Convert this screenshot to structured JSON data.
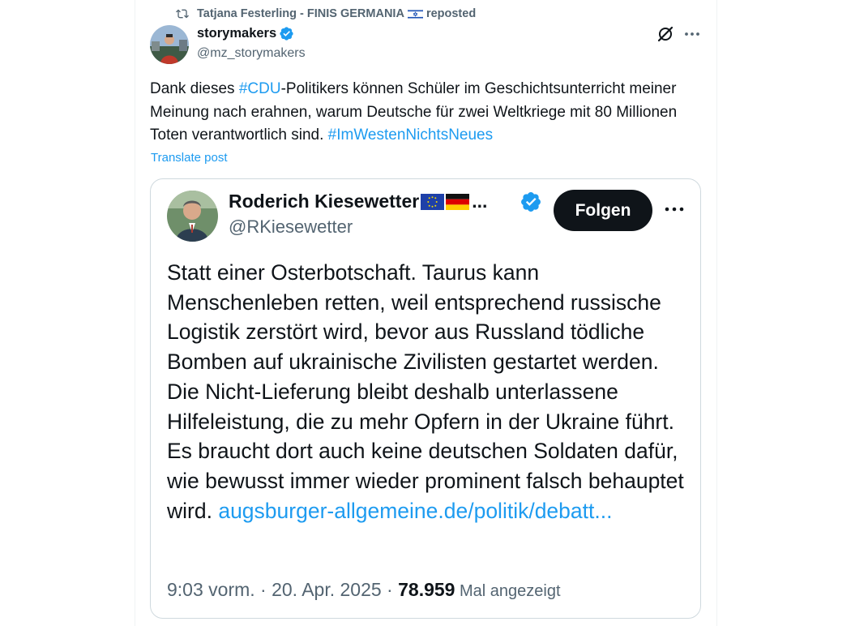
{
  "repost": {
    "user": "Tatjana Festerling - FINIS GERMANIA",
    "label": "reposted",
    "icon": "repost-icon"
  },
  "post": {
    "display_name": "storymakers",
    "handle": "@mz_storymakers",
    "text_1": "Dank dieses ",
    "hashtag_1": "#CDU",
    "text_2": "-Politikers können Schüler im Geschichtsunterricht meiner Meinung nach erahnen, warum Deutsche für zwei Weltkriege mit 80 Millionen Toten verantwortlich sind. ",
    "hashtag_2": "#ImWestenNichtsNeues",
    "translate_label": "Translate post"
  },
  "quote": {
    "display_name": "Roderich Kiesewetter",
    "ellipsis": "...",
    "handle": "@RKiesewetter",
    "follow_label": "Folgen",
    "text": "Statt einer Osterbotschaft. Taurus kann Menschenleben retten, weil entsprechend russische Logistik zerstört wird, bevor aus Russland tödliche Bomben auf ukrainische Zivilisten gestartet werden. Die Nicht-Lieferung bleibt deshalb unterlassene Hilfeleistung, die zu mehr Opfern in der Ukraine führt. Es braucht dort auch keine deutschen Soldaten dafür, wie bewusst immer wieder prominent falsch behauptet wird.",
    "link": "augsburger-allgemeine.de/politik/debatt...",
    "time": "9:03 vorm. · 20. Apr. 2025 · ",
    "views": "78.959",
    "views_label": " Mal angezeigt"
  },
  "colors": {
    "accent": "#1d9bf0",
    "text": "#0f1419",
    "secondary": "#536471",
    "border": "#cfd9de"
  }
}
